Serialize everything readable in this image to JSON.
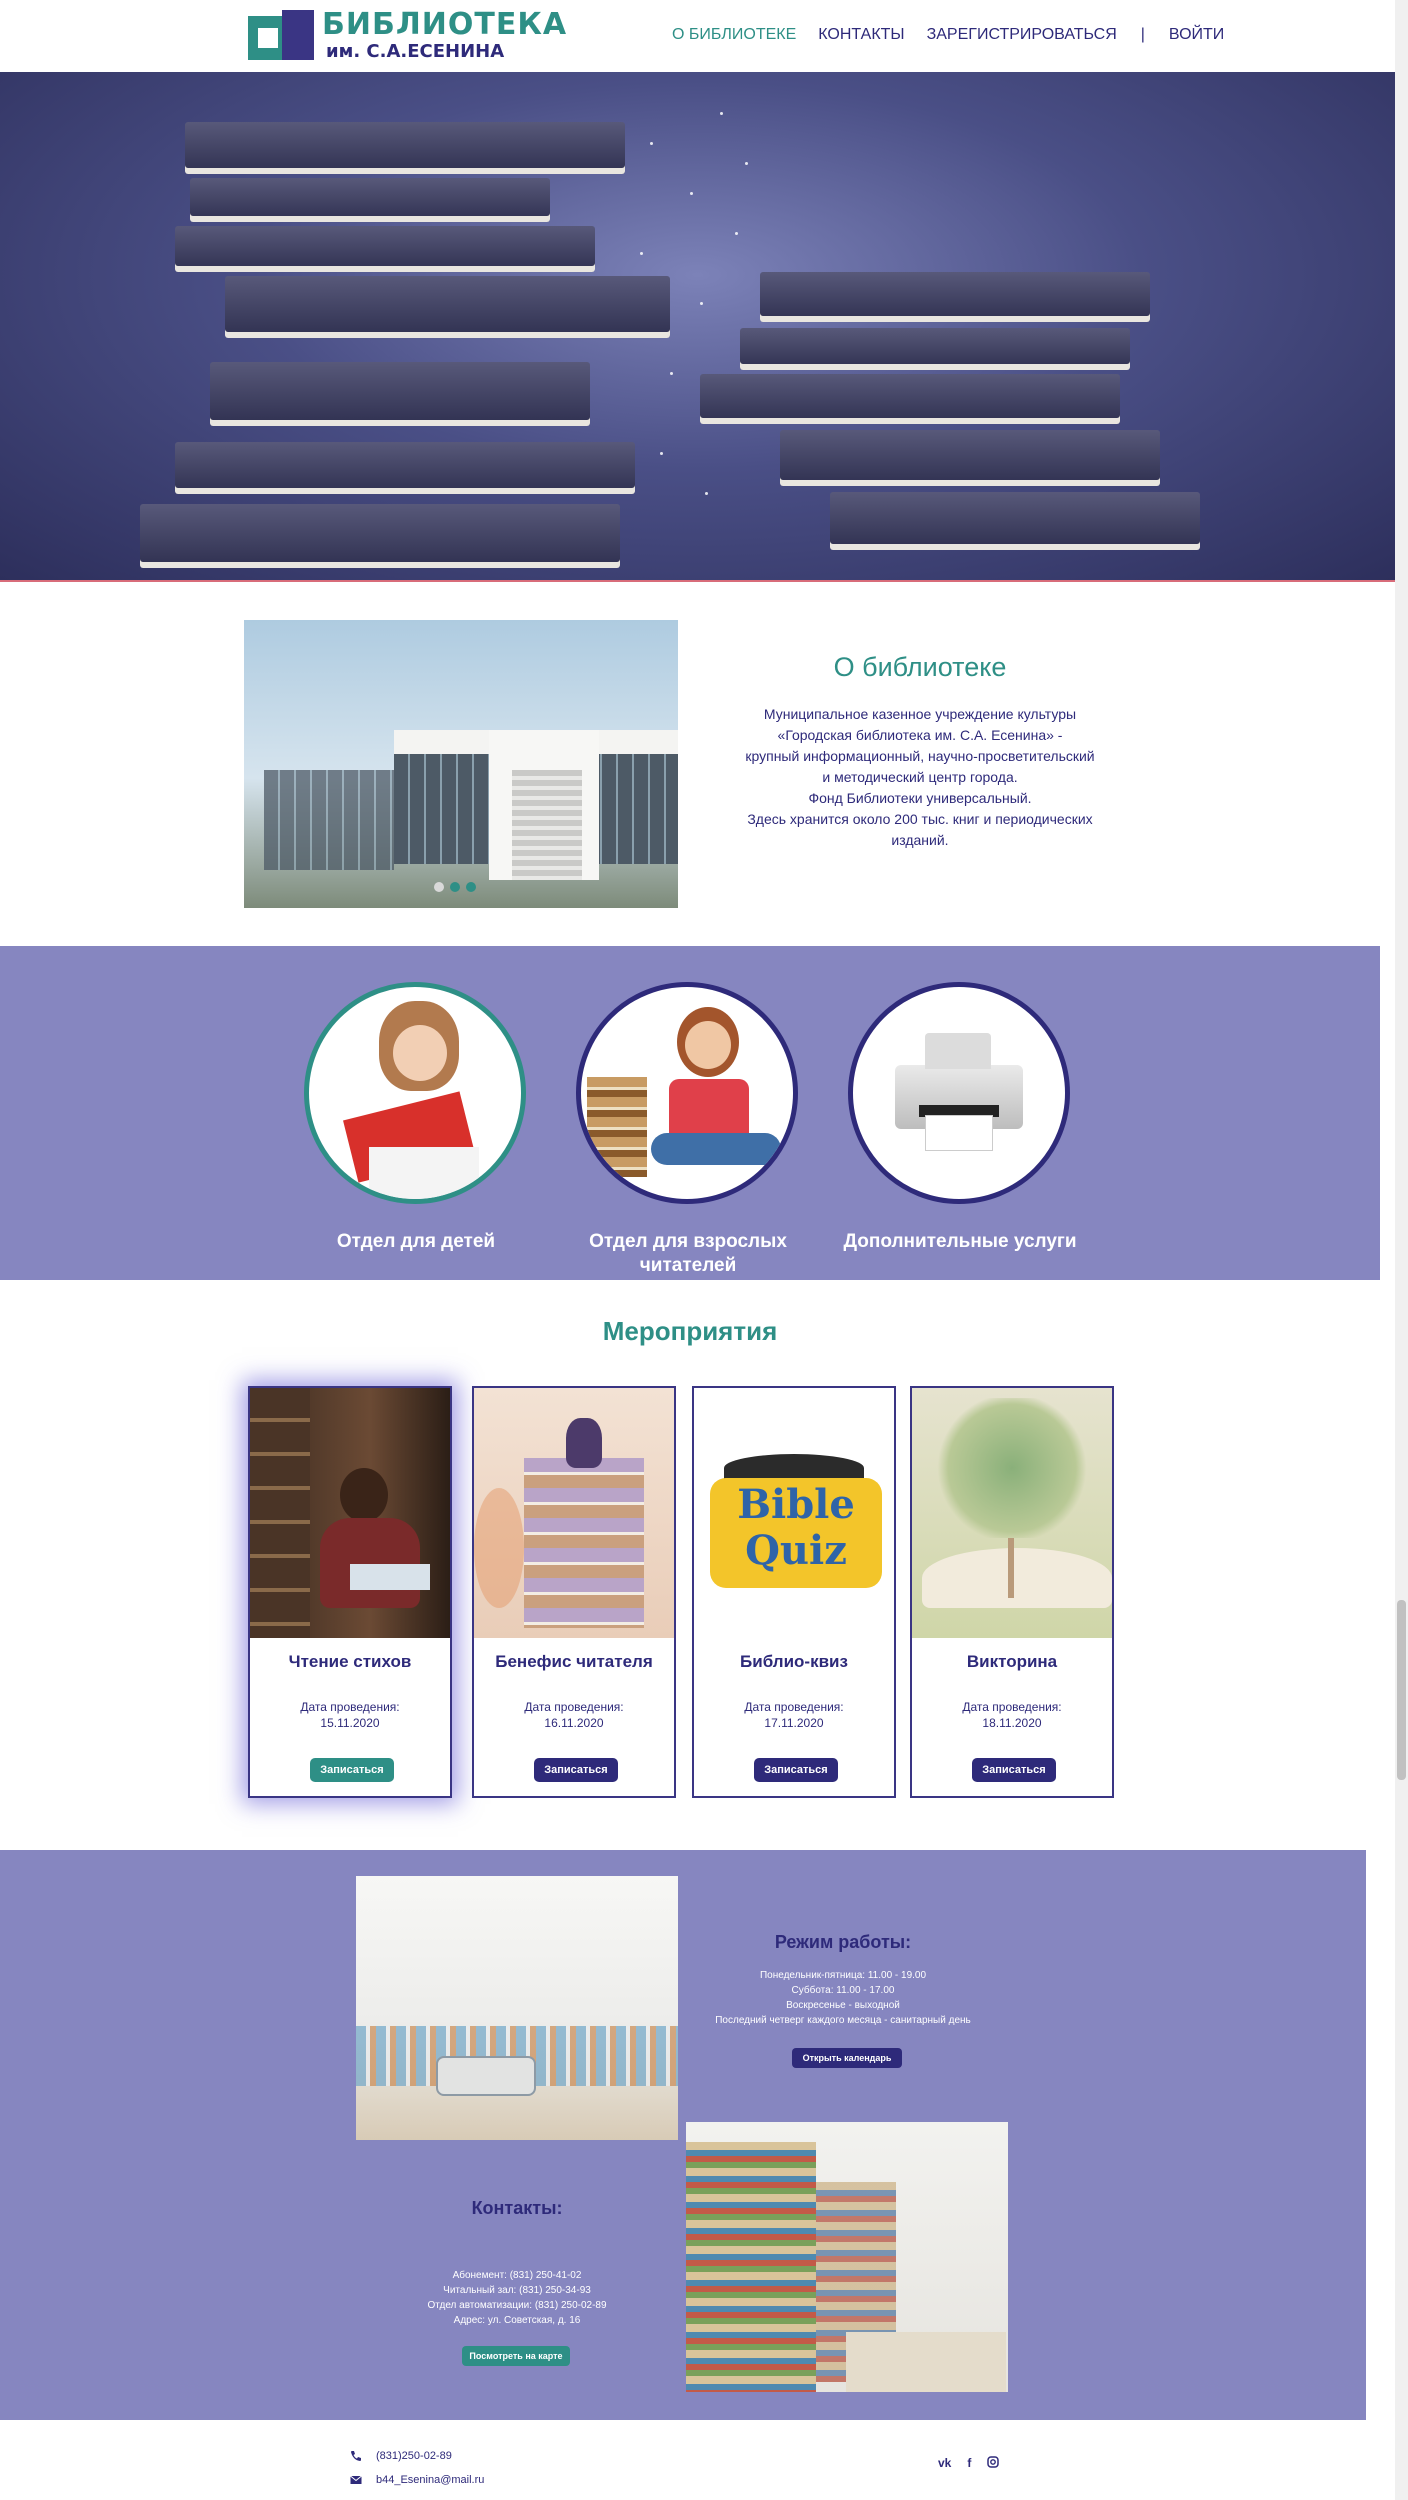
{
  "header": {
    "logo_title": "БИБЛИОТЕКА",
    "logo_subtitle": "им. С.А.ЕСЕНИНА",
    "nav": {
      "about": "О БИБЛИОТЕКЕ",
      "contacts": "КОНТАКТЫ",
      "register": "ЗАРЕГИСТРИРОВАТЬСЯ",
      "separator": "|",
      "login": "ВОЙТИ"
    }
  },
  "about": {
    "title": "О библиотеке",
    "lines": [
      "Муниципальное казенное учреждение культуры",
      "«Городская библиотека им. С.А. Есенина» -",
      "крупный информационный, научно-просветительский",
      "и методический центр города.",
      "Фонд Библиотеки универсальный.",
      "Здесь хранится около 200 тыс. книг и периодических",
      "изданий."
    ]
  },
  "departments": [
    {
      "label": "Отдел для детей"
    },
    {
      "label": "Отдел для взрослых читателей"
    },
    {
      "label": "Дополнительные услуги"
    }
  ],
  "events": {
    "title": "Мероприятия",
    "date_label": "Дата проведения:",
    "button_label": "Записаться",
    "items": [
      {
        "name": "Чтение стихов",
        "date": "15.11.2020"
      },
      {
        "name": "Бенефис читателя",
        "date": "16.11.2020"
      },
      {
        "name": "Библио-квиз",
        "date": "17.11.2020"
      },
      {
        "name": "Викторина",
        "date": "18.11.2020"
      }
    ],
    "quiz_logo_text": [
      "Bible",
      "Quiz"
    ]
  },
  "schedule": {
    "title": "Режим работы:",
    "lines": [
      "Понедельник-пятница: 11.00 - 19.00",
      "Суббота: 11.00 - 17.00",
      "Воскресенье - выходной",
      "Последний четверг каждого месяца - санитарный день"
    ],
    "button": "Открыть календарь"
  },
  "contacts": {
    "title": "Контакты:",
    "lines": [
      "Абонемент: (831) 250-41-02",
      "Читальный зал: (831) 250-34-93",
      "Отдел автоматизации: (831) 250-02-89",
      "Адрес: ул. Советская, д. 16"
    ],
    "button": "Посмотреть на карте"
  },
  "footer": {
    "phone": "(831)250-02-89",
    "email": "b44_Esenina@mail.ru",
    "social": [
      "vk",
      "f",
      "ig"
    ]
  },
  "colors": {
    "teal": "#2e8f86",
    "indigo": "#2e2a7a",
    "lavender": "#8686c0"
  }
}
